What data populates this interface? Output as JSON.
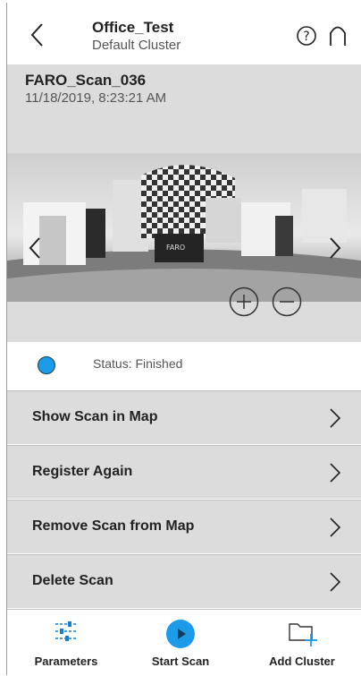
{
  "header": {
    "title": "Office_Test",
    "subtitle": "Default Cluster",
    "icons": [
      "chevron-left-icon",
      "help-icon",
      "home-icon"
    ]
  },
  "scan": {
    "name": "FARO_Scan_036",
    "date": "11/18/2019, 8:23:21 AM"
  },
  "status": {
    "text": "Status: Finished",
    "color": "#1c9be8"
  },
  "actions": [
    {
      "label": "Show Scan in Map"
    },
    {
      "label": "Register Again"
    },
    {
      "label": "Remove Scan from Map"
    },
    {
      "label": "Delete Scan"
    }
  ],
  "toolbar": {
    "parameters": "Parameters",
    "start_scan": "Start Scan",
    "add_cluster": "Add Cluster",
    "accent": "#1c9be8"
  }
}
